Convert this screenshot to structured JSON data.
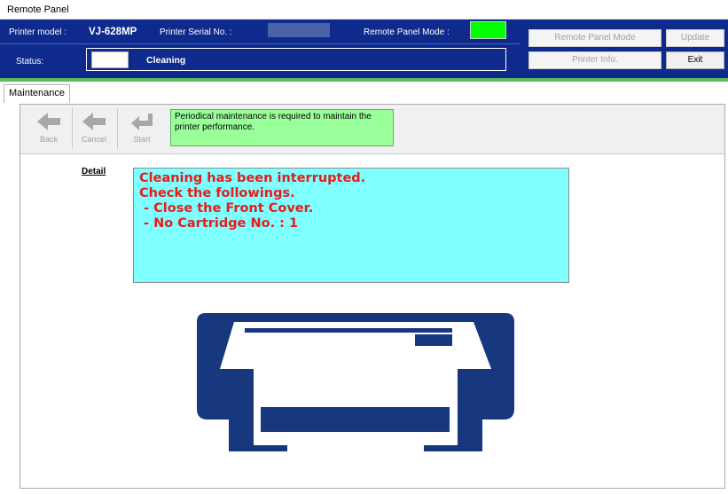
{
  "window": {
    "title": "Remote Panel"
  },
  "header": {
    "printer_model_label": "Printer model :",
    "printer_model_value": "VJ-628MP",
    "serial_label": "Printer Serial No. :",
    "remote_mode_label": "Remote Panel Mode :",
    "remote_mode_color": "#00ff00",
    "status_label": "Status:",
    "status_value": "Cleaning"
  },
  "buttons": {
    "remote_panel_mode": "Remote Panel Mode",
    "update": "Update",
    "printer_info": "Printer Info.",
    "exit": "Exit"
  },
  "tabs": [
    {
      "label": "Maintenance",
      "active": true
    }
  ],
  "toolbar": {
    "back": {
      "label": "Back",
      "icon": "arrow-left-icon",
      "enabled": false
    },
    "cancel": {
      "label": "Cancel",
      "icon": "arrow-left-icon",
      "enabled": false
    },
    "start": {
      "label": "Start",
      "icon": "return-arrow-icon",
      "enabled": false
    },
    "notice": "Periodical maintenance is required to maintain the printer performance."
  },
  "detail": {
    "label": "Detail",
    "lines": [
      "Cleaning has been interrupted.",
      "Check the followings.",
      " - Close the Front Cover.",
      " - No Cartridge No. : 1"
    ]
  },
  "colors": {
    "header_bg": "#0e2a8c",
    "printer_icon": "#17387f",
    "detail_bg": "#80ffff",
    "detail_text": "#e51c1c",
    "notice_bg": "#99ff99"
  }
}
